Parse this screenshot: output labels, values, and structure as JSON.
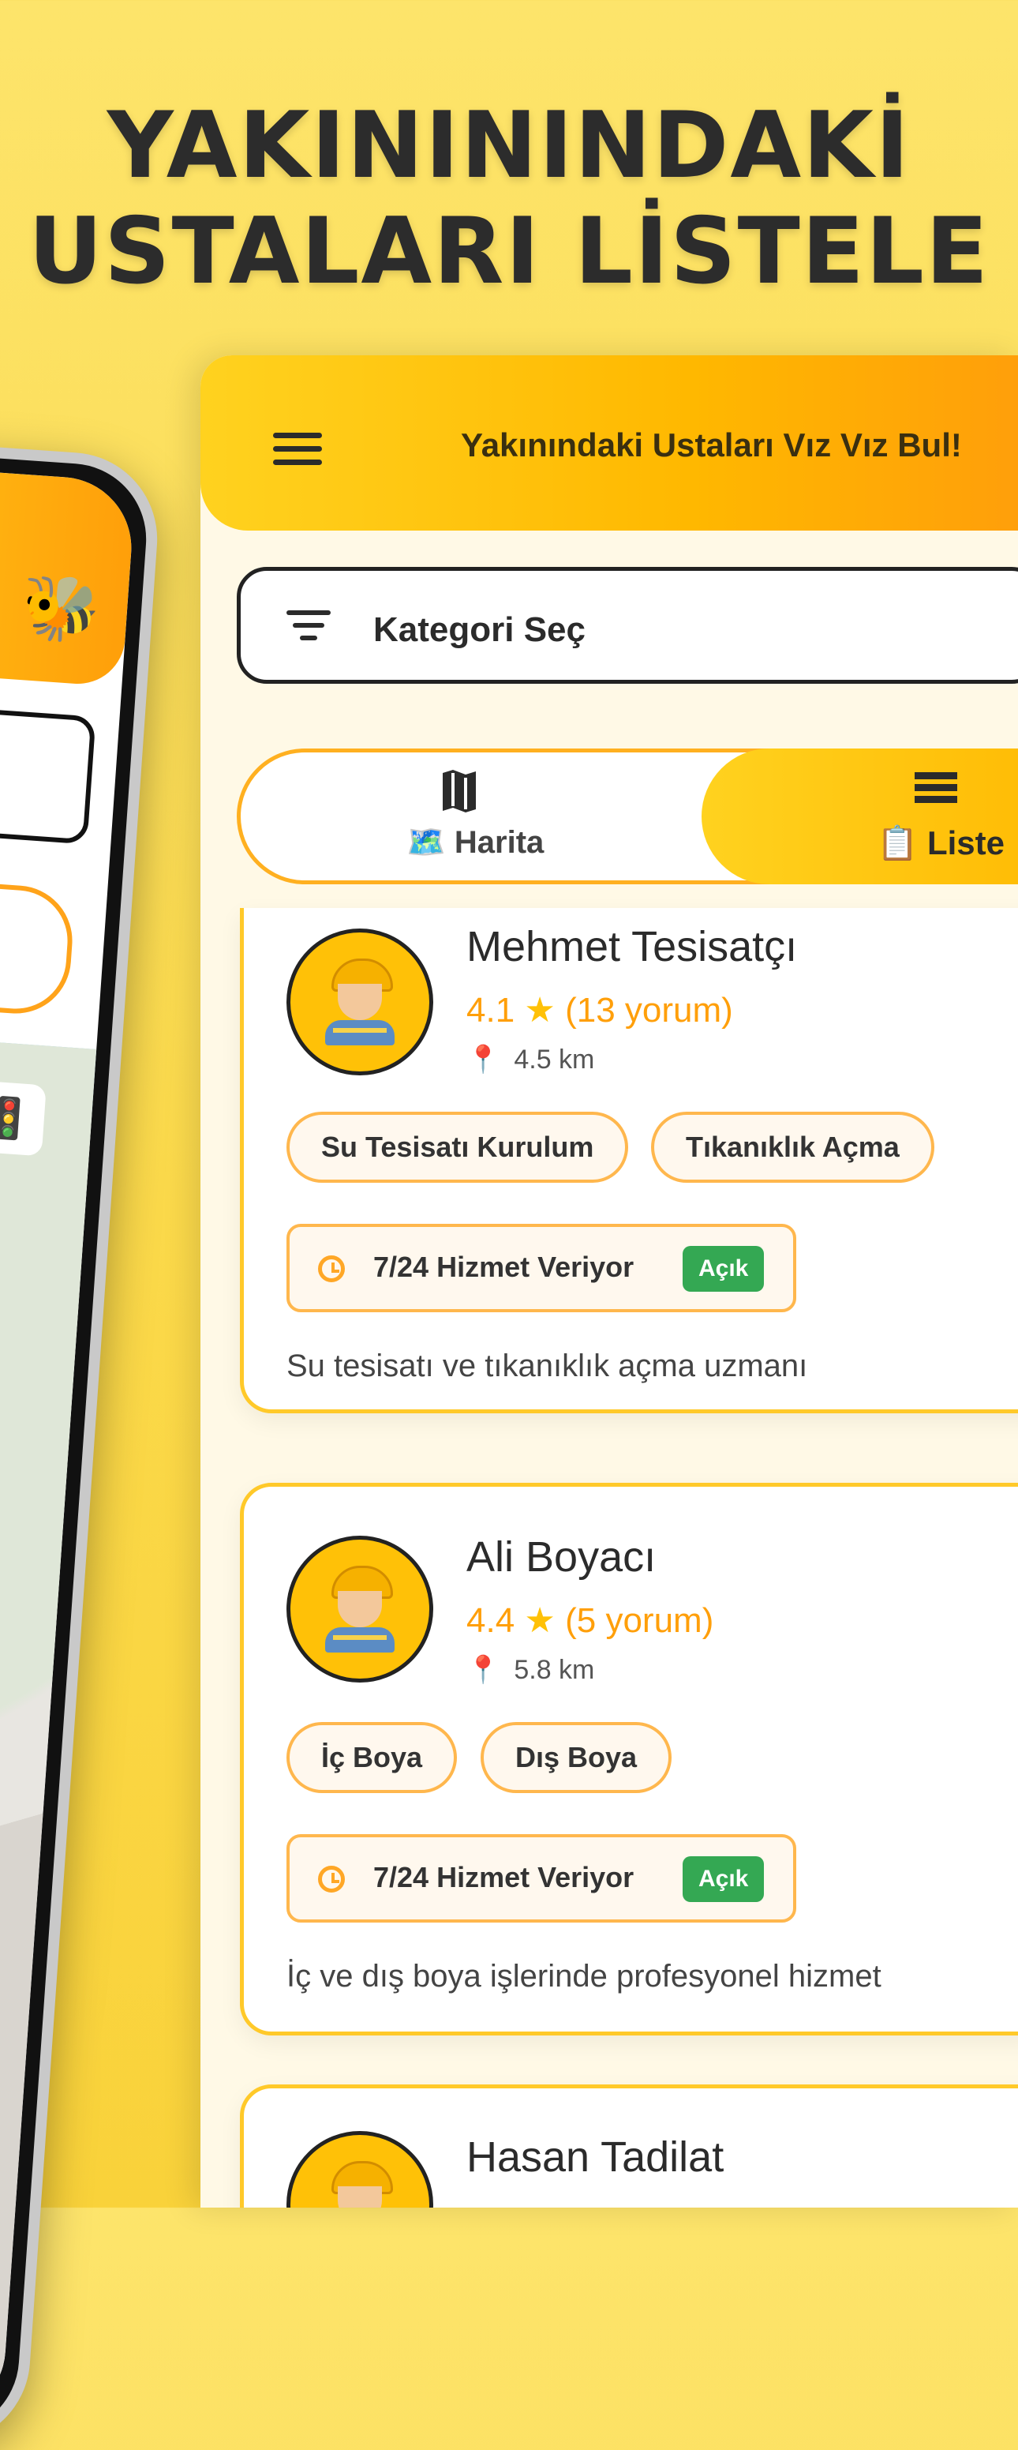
{
  "headline": {
    "line1": "YAKINININDAKİ",
    "line2": "USTALARI LİSTELE"
  },
  "header": {
    "title": "Yakınındaki Ustaları Vız Vız Bul!"
  },
  "filter": {
    "label": "Kategori Seç"
  },
  "tabs": {
    "map_label": "🗺️ Harita",
    "list_label": "📋 Liste"
  },
  "professionals": [
    {
      "name": "Mehmet Tesisatçı",
      "rating": "4.1",
      "reviews": "(13 yorum)",
      "distance": "4.5 km",
      "services": [
        "Su Tesisatı Kurulum",
        "Tıkanıklık Açma"
      ],
      "hours": "7/24 Hizmet Veriyor",
      "status": "Açık",
      "description": "Su tesisatı ve tıkanıklık açma uzmanı"
    },
    {
      "name": "Ali Boyacı",
      "rating": "4.4",
      "reviews": "(5 yorum)",
      "distance": "5.8 km",
      "services": [
        "İç Boya",
        "Dış Boya"
      ],
      "hours": "7/24 Hizmet Veriyor",
      "status": "Açık",
      "description": "İç ve dış boya işlerinde profesyonel hizmet"
    },
    {
      "name": "Hasan Tadilat"
    }
  ],
  "icons": {
    "menu": "hamburger-menu-icon",
    "filter": "filter-icon",
    "map": "map-icon",
    "list": "list-icon",
    "clock": "clock-icon",
    "pin": "location-pin-icon"
  },
  "colors": {
    "background": "#fbd94a",
    "accent": "#ffb800",
    "rating": "#ff9f0a",
    "status_open": "#34a853"
  }
}
